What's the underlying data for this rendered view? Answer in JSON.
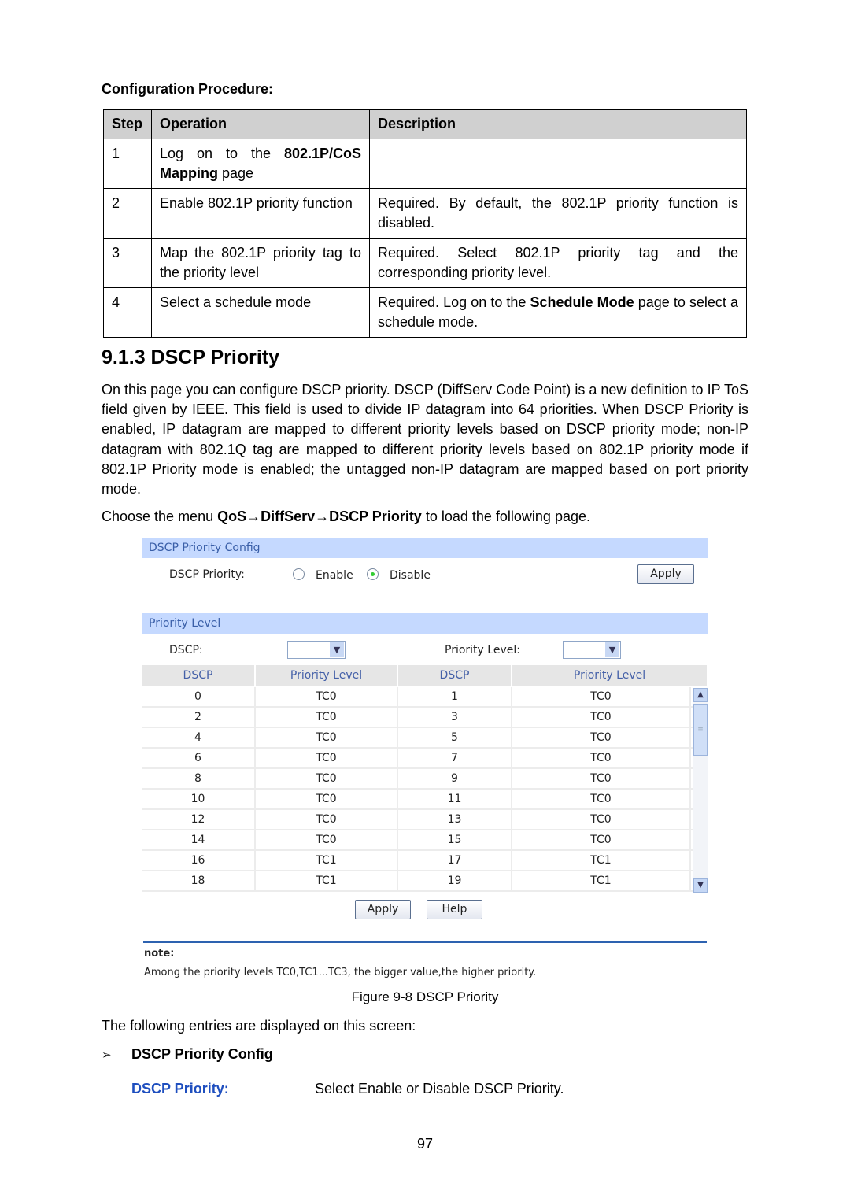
{
  "procedure": {
    "heading": "Configuration Procedure:",
    "headers": [
      "Step",
      "Operation",
      "Description"
    ],
    "rows": [
      {
        "step": "1",
        "op_pre": "Log on to the ",
        "op_bold": "802.1P/CoS Mapping",
        "op_post": " page",
        "desc_pre": "",
        "desc_bold": "",
        "desc_post": ""
      },
      {
        "step": "2",
        "op_pre": "Enable 802.1P priority function",
        "op_bold": "",
        "op_post": "",
        "desc_pre": "Required. By default, the 802.1P priority function is disabled.",
        "desc_bold": "",
        "desc_post": ""
      },
      {
        "step": "3",
        "op_pre": "Map the 802.1P priority tag to the priority level",
        "op_bold": "",
        "op_post": "",
        "desc_pre": "Required. Select 802.1P priority tag and the corresponding priority level.",
        "desc_bold": "",
        "desc_post": ""
      },
      {
        "step": "4",
        "op_pre": "Select a schedule mode",
        "op_bold": "",
        "op_post": "",
        "desc_pre": "Required. Log on to the ",
        "desc_bold": "Schedule Mode",
        "desc_post": " page to select a schedule mode."
      }
    ]
  },
  "section": {
    "title": "9.1.3 DSCP Priority",
    "paragraph": "On this page you can configure DSCP priority. DSCP (DiffServ Code Point) is a new definition to IP ToS field given by IEEE. This field is used to divide IP datagram into 64 priorities. When DSCP Priority is enabled, IP datagram are mapped to different priority levels based on DSCP priority mode; non-IP datagram with 802.1Q tag are mapped to different priority levels based on 802.1P priority mode if 802.1P Priority mode is enabled; the untagged non-IP datagram are mapped based on port priority mode.",
    "choose_pre": "Choose the menu ",
    "choose_menu": "QoS→DiffServ→DSCP Priority",
    "choose_post": " to load the following page."
  },
  "screen": {
    "config_title": "DSCP Priority Config",
    "dscp_priority_label": "DSCP Priority:",
    "enable_label": "Enable",
    "disable_label": "Disable",
    "selected": "Disable",
    "apply_label": "Apply",
    "level_title": "Priority Level",
    "dscp_label": "DSCP:",
    "level_label": "Priority Level:",
    "columns": [
      "DSCP",
      "Priority Level",
      "DSCP",
      "Priority Level"
    ],
    "rows": [
      [
        "0",
        "TC0",
        "1",
        "TC0"
      ],
      [
        "2",
        "TC0",
        "3",
        "TC0"
      ],
      [
        "4",
        "TC0",
        "5",
        "TC0"
      ],
      [
        "6",
        "TC0",
        "7",
        "TC0"
      ],
      [
        "8",
        "TC0",
        "9",
        "TC0"
      ],
      [
        "10",
        "TC0",
        "11",
        "TC0"
      ],
      [
        "12",
        "TC0",
        "13",
        "TC0"
      ],
      [
        "14",
        "TC0",
        "15",
        "TC0"
      ],
      [
        "16",
        "TC1",
        "17",
        "TC1"
      ],
      [
        "18",
        "TC1",
        "19",
        "TC1"
      ]
    ],
    "apply2_label": "Apply",
    "help_label": "Help",
    "note_title": "note:",
    "note_text": "Among the priority levels TC0,TC1...TC3, the bigger value,the higher priority."
  },
  "caption": "Figure 9-8 DSCP Priority",
  "entries_intro": "The following entries are displayed on this screen:",
  "bullet": {
    "icon": "arrow-bullet-icon",
    "title": "DSCP Priority Config"
  },
  "field": {
    "name": "DSCP Priority:",
    "desc": "Select Enable or Disable DSCP Priority.",
    "color": "#1f4fbf"
  },
  "page_number": "97"
}
